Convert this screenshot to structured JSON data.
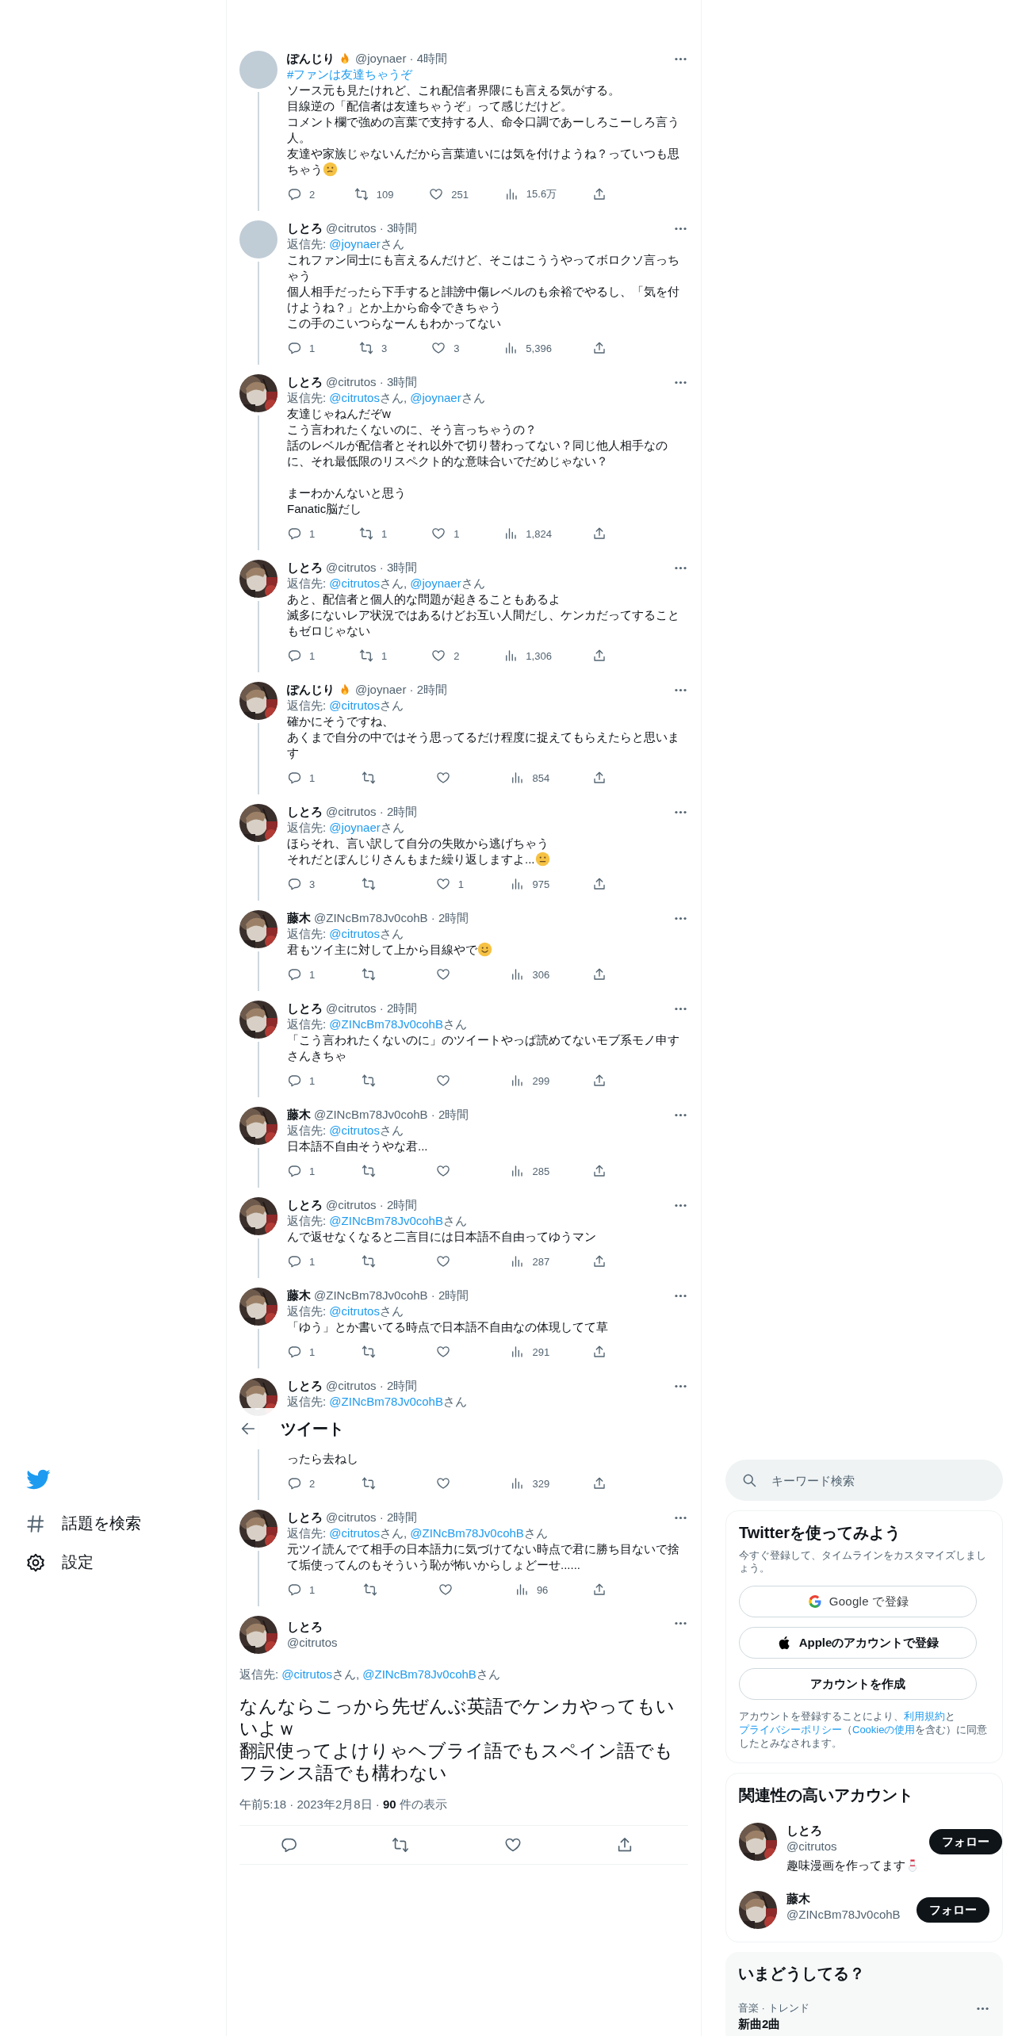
{
  "nav": {
    "logo": {
      "kind": "bird"
    },
    "items": [
      {
        "kind": "hash",
        "label": "話題を検索"
      },
      {
        "kind": "gear",
        "label": "設定"
      }
    ]
  },
  "header": {
    "title": "ツイート"
  },
  "tweets": [
    {
      "kind": "reply",
      "avatar": {
        "kind": "placeholder"
      },
      "author": "ぽんじり",
      "badge": {
        "kind": "fire"
      },
      "meta": "@joynaer · 4時間",
      "hashtag": "#ファンは友達ちゃうぞ",
      "paragraphs": [
        [
          "ソース元も見たけれど、これ配信者界隈にも言える気がする。",
          "目線逆の「配信者は友達ちゃうぞ」って感じだけど。",
          "コメント欄で強めの言葉で支持する人、命令口調であーしろこーしろ言う人。",
          "友達や家族じゃないんだから言葉遣いには気を付けようね？っていつも思",
          "ちゃう"
        ]
      ],
      "emoji": {
        "kind": "thinking"
      },
      "actions": {
        "reply": "2",
        "retweet": "109",
        "like": "251",
        "views": "15.6万"
      }
    },
    {
      "kind": "reply",
      "avatar": {
        "kind": "placeholder"
      },
      "author": "しとろ",
      "meta": "@citrutos · 3時間",
      "reply": {
        "label": "返信先:",
        "mentions": [
          {
            "handle": "@joynaer",
            "suffix": "さん"
          }
        ]
      },
      "paragraphs": [
        [
          "これファン同士にも言えるんだけど、そこはこううやってボロクソ言っちゃう",
          "個人相手だったら下手すると誹謗中傷レベルのも余裕でやるし、「気を付けようね？」とか上から命令できちゃう",
          "この手のこいつらなーんもわかってない"
        ]
      ],
      "actions": {
        "reply": "1",
        "retweet": "3",
        "like": "3",
        "views": "5,396"
      }
    },
    {
      "kind": "reply",
      "avatar": {
        "kind": "picture"
      },
      "author": "しとろ",
      "meta": "@citrutos · 3時間",
      "reply": {
        "label": "返信先:",
        "mentions": [
          {
            "handle": "@citrutos",
            "suffix": "さん,"
          },
          {
            "handle": "@joynaer",
            "suffix": "さん"
          }
        ]
      },
      "paragraphs": [
        [
          "友達じゃねんだぞw",
          "こう言われたくないのに、そう言っちゃうの？",
          "話のレベルが配信者とそれ以外で切り替わってない？同じ他人相手なのに、それ最低限のリスペクト的な意味合いでだめじゃない？"
        ],
        [
          "まーわかんないと思う",
          "Fanatic脳だし"
        ]
      ],
      "actions": {
        "reply": "1",
        "retweet": "1",
        "like": "1",
        "views": "1,824"
      }
    },
    {
      "kind": "reply",
      "avatar": {
        "kind": "picture"
      },
      "author": "しとろ",
      "meta": "@citrutos · 3時間",
      "reply": {
        "label": "返信先:",
        "mentions": [
          {
            "handle": "@citrutos",
            "suffix": "さん,"
          },
          {
            "handle": "@joynaer",
            "suffix": "さん"
          }
        ]
      },
      "paragraphs": [
        [
          "あと、配信者と個人的な問題が起きることもあるよ",
          "滅多にないレア状況ではあるけどお互い人間だし、ケンカだってすることもゼロじゃない"
        ]
      ],
      "actions": {
        "reply": "1",
        "retweet": "1",
        "like": "2",
        "views": "1,306"
      }
    },
    {
      "kind": "reply",
      "avatar": {
        "kind": "picture"
      },
      "author": "ぽんじり",
      "badge": {
        "kind": "fire"
      },
      "meta": "@joynaer · 2時間",
      "reply": {
        "label": "返信先:",
        "mentions": [
          {
            "handle": "@citrutos",
            "suffix": "さん"
          }
        ]
      },
      "paragraphs": [
        [
          "確かにそうですね、",
          "あくまで自分の中ではそう思ってるだけ程度に捉えてもらえたらと思います"
        ]
      ],
      "actions": {
        "reply": "1",
        "views": "854"
      }
    },
    {
      "kind": "reply",
      "avatar": {
        "kind": "picture"
      },
      "author": "しとろ",
      "meta": "@citrutos · 2時間",
      "reply": {
        "label": "返信先:",
        "mentions": [
          {
            "handle": "@joynaer",
            "suffix": "さん"
          }
        ]
      },
      "paragraphs": [
        [
          "ほらそれ、言い訳して自分の失敗から逃げちゃう",
          "それだとぽんじりさんもまた繰り返しますよ..."
        ]
      ],
      "emoji": {
        "kind": "uneasy"
      },
      "actions": {
        "reply": "3",
        "like": "1",
        "views": "975"
      }
    },
    {
      "kind": "reply",
      "avatar": {
        "kind": "picture"
      },
      "author": "藤木",
      "meta": "@ZINcBm78Jv0cohB · 2時間",
      "reply": {
        "label": "返信先:",
        "mentions": [
          {
            "handle": "@citrutos",
            "suffix": "さん"
          }
        ]
      },
      "paragraphs": [
        [
          "君もツイ主に対して上から目線やで"
        ]
      ],
      "emoji": {
        "kind": "smiling"
      },
      "actions": {
        "reply": "1",
        "views": "306"
      }
    },
    {
      "kind": "reply",
      "avatar": {
        "kind": "picture"
      },
      "author": "しとろ",
      "meta": "@citrutos · 2時間",
      "reply": {
        "label": "返信先:",
        "mentions": [
          {
            "handle": "@ZINcBm78Jv0cohB",
            "suffix": "さん"
          }
        ]
      },
      "paragraphs": [
        [
          "「こう言われたくないのに」のツイートやっぱ読めてないモブ系モノ申すさんきちゃ"
        ]
      ],
      "actions": {
        "reply": "1",
        "views": "299"
      }
    },
    {
      "kind": "reply",
      "avatar": {
        "kind": "picture"
      },
      "author": "藤木",
      "meta": "@ZINcBm78Jv0cohB · 2時間",
      "reply": {
        "label": "返信先:",
        "mentions": [
          {
            "handle": "@citrutos",
            "suffix": "さん"
          }
        ]
      },
      "paragraphs": [
        [
          "日本語不自由そうやな君..."
        ]
      ],
      "actions": {
        "reply": "1",
        "views": "285"
      }
    },
    {
      "kind": "reply",
      "avatar": {
        "kind": "picture"
      },
      "author": "しとろ",
      "meta": "@citrutos · 2時間",
      "reply": {
        "label": "返信先:",
        "mentions": [
          {
            "handle": "@ZINcBm78Jv0cohB",
            "suffix": "さん"
          }
        ]
      },
      "paragraphs": [
        [
          "んで返せなくなると二言目には日本語不自由ってゆうマン"
        ]
      ],
      "actions": {
        "reply": "1",
        "views": "287"
      }
    },
    {
      "kind": "reply",
      "avatar": {
        "kind": "picture"
      },
      "author": "藤木",
      "meta": "@ZINcBm78Jv0cohB · 2時間",
      "reply": {
        "label": "返信先:",
        "mentions": [
          {
            "handle": "@citrutos",
            "suffix": "さん"
          }
        ]
      },
      "paragraphs": [
        [
          "「ゆう」とか書いてる時点で日本語不自由なの体現してて草"
        ]
      ],
      "actions": {
        "reply": "1",
        "views": "291"
      }
    },
    {
      "kind": "covered",
      "avatar": {
        "kind": "picture"
      },
      "author": "しとろ",
      "meta": "@citrutos · 2時間",
      "reply": {
        "label": "返信先:",
        "mentions": [
          {
            "handle": "@ZINcBm78Jv0cohB",
            "suffix": "さん"
          }
        ]
      },
      "paragraphs": [
        [
          "ったら去ねし"
        ]
      ],
      "actions": {
        "reply": "2",
        "views": "329"
      }
    },
    {
      "kind": "reply",
      "avatar": {
        "kind": "picture"
      },
      "author": "しとろ",
      "meta": "@citrutos · 2時間",
      "reply": {
        "label": "返信先:",
        "mentions": [
          {
            "handle": "@citrutos",
            "suffix": "さん,"
          },
          {
            "handle": "@ZINcBm78Jv0cohB",
            "suffix": "さん"
          }
        ]
      },
      "paragraphs": [
        [
          "元ツイ読んでて相手の日本語力に気づけてない時点で君に勝ち目ないで捨て垢使ってんのもそういう恥が怖いからしょどーせ......"
        ]
      ],
      "actions": {
        "reply": "1",
        "views": "96"
      }
    },
    {
      "kind": "main",
      "avatar": {
        "kind": "picture"
      },
      "author": "しとろ",
      "meta": "@citrutos",
      "reply": {
        "label": "返信先:",
        "mentions": [
          {
            "handle": "@citrutos",
            "suffix": "さん,"
          },
          {
            "handle": "@ZINcBm78Jv0cohB",
            "suffix": "さん"
          }
        ]
      },
      "paragraphs": [
        [
          "なんならこっから先ぜんぶ英語でケンカやってもいいよｗ",
          "翻訳使ってよけりゃヘブライ語でもスペイン語でもフランス語でも構わない"
        ]
      ],
      "stamp": "午前5:18 · 2023年2月8日 · **90** 件の表示"
    }
  ],
  "search": {
    "placeholder": "キーワード検索"
  },
  "signup": {
    "title": "Twitterを使ってみよう",
    "subtitle": "今すぐ登録して、タイムラインをカスタマイズしましょう。",
    "buttons": [
      {
        "kind": "google",
        "label": "Google で登録"
      },
      {
        "kind": "apple",
        "label": "Appleのアカウントで登録"
      },
      {
        "kind": "create",
        "label": "アカウントを作成"
      }
    ],
    "legal": [
      {
        "kind": "text",
        "text": "アカウントを登録することにより、"
      },
      {
        "kind": "link",
        "text": "利用規約"
      },
      {
        "kind": "text",
        "text": "と"
      },
      {
        "kind": "link",
        "text": "プライバシーポリシー"
      },
      {
        "kind": "text",
        "text": "（"
      },
      {
        "kind": "link",
        "text": "Cookieの使用"
      },
      {
        "kind": "text",
        "text": "を含む）に同意したとみなされます。"
      }
    ]
  },
  "related": {
    "title": "関連性の高いアカウント",
    "accounts": [
      {
        "avatar": {
          "kind": "picture"
        },
        "name": "しとろ",
        "handle": "@citrutos",
        "bio": "趣味漫画を作ってます",
        "bio_emoji": {
          "kind": "snowman"
        },
        "follow": "フォロー"
      },
      {
        "avatar": {
          "kind": "picture"
        },
        "name": "藤木",
        "handle": "@ZINcBm78Jv0cohB",
        "follow": "フォロー"
      }
    ]
  },
  "trends": {
    "title": "いまどうしてる？",
    "items": [
      {
        "category": "音楽 · トレンド",
        "name": "新曲2曲"
      }
    ]
  }
}
